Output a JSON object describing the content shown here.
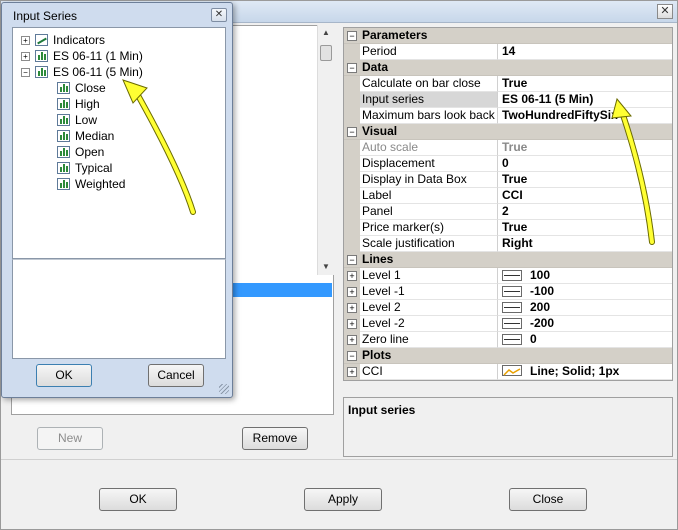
{
  "main": {
    "close_glyph": "✕",
    "buttons": {
      "new": "New",
      "remove": "Remove",
      "ok": "OK",
      "apply": "Apply",
      "close": "Close"
    }
  },
  "grid": {
    "parameters": {
      "title": "Parameters",
      "period": {
        "name": "Period",
        "value": "14"
      }
    },
    "data": {
      "title": "Data",
      "calculate": {
        "name": "Calculate on bar close",
        "value": "True"
      },
      "input_series": {
        "name": "Input series",
        "value": "ES 06-11 (5 Min)"
      },
      "max_bars": {
        "name": "Maximum bars look back",
        "value": "TwoHundredFiftySix"
      }
    },
    "visual": {
      "title": "Visual",
      "auto_scale": {
        "name": "Auto scale",
        "value": "True"
      },
      "displacement": {
        "name": "Displacement",
        "value": "0"
      },
      "display_data_box": {
        "name": "Display in Data Box",
        "value": "True"
      },
      "label": {
        "name": "Label",
        "value": "CCI"
      },
      "panel": {
        "name": "Panel",
        "value": "2"
      },
      "price_marker": {
        "name": "Price marker(s)",
        "value": "True"
      },
      "scale_justification": {
        "name": "Scale justification",
        "value": "Right"
      }
    },
    "lines": {
      "title": "Lines",
      "items": [
        {
          "name": "Level 1",
          "value": "100"
        },
        {
          "name": "Level -1",
          "value": "-100"
        },
        {
          "name": "Level 2",
          "value": "200"
        },
        {
          "name": "Level -2",
          "value": "-200"
        },
        {
          "name": "Zero line",
          "value": "0"
        }
      ]
    },
    "plots": {
      "title": "Plots",
      "cci": {
        "name": "CCI",
        "value": "Line; Solid; 1px"
      }
    },
    "expand_glyph": "+",
    "collapse_glyph": "−"
  },
  "description": {
    "title": "Input series"
  },
  "popup": {
    "title": "Input Series",
    "close_glyph": "✕",
    "tree": {
      "indicators": "Indicators",
      "es_1min": "ES 06-11 (1 Min)",
      "es_5min": "ES 06-11 (5 Min)",
      "children": [
        "Close",
        "High",
        "Low",
        "Median",
        "Open",
        "Typical",
        "Weighted"
      ]
    },
    "ok": "OK",
    "cancel": "Cancel"
  },
  "colors": {
    "annotation_arrow": "#ffff33",
    "selection": "#3399ff",
    "category_background": "#d4d0c8"
  }
}
